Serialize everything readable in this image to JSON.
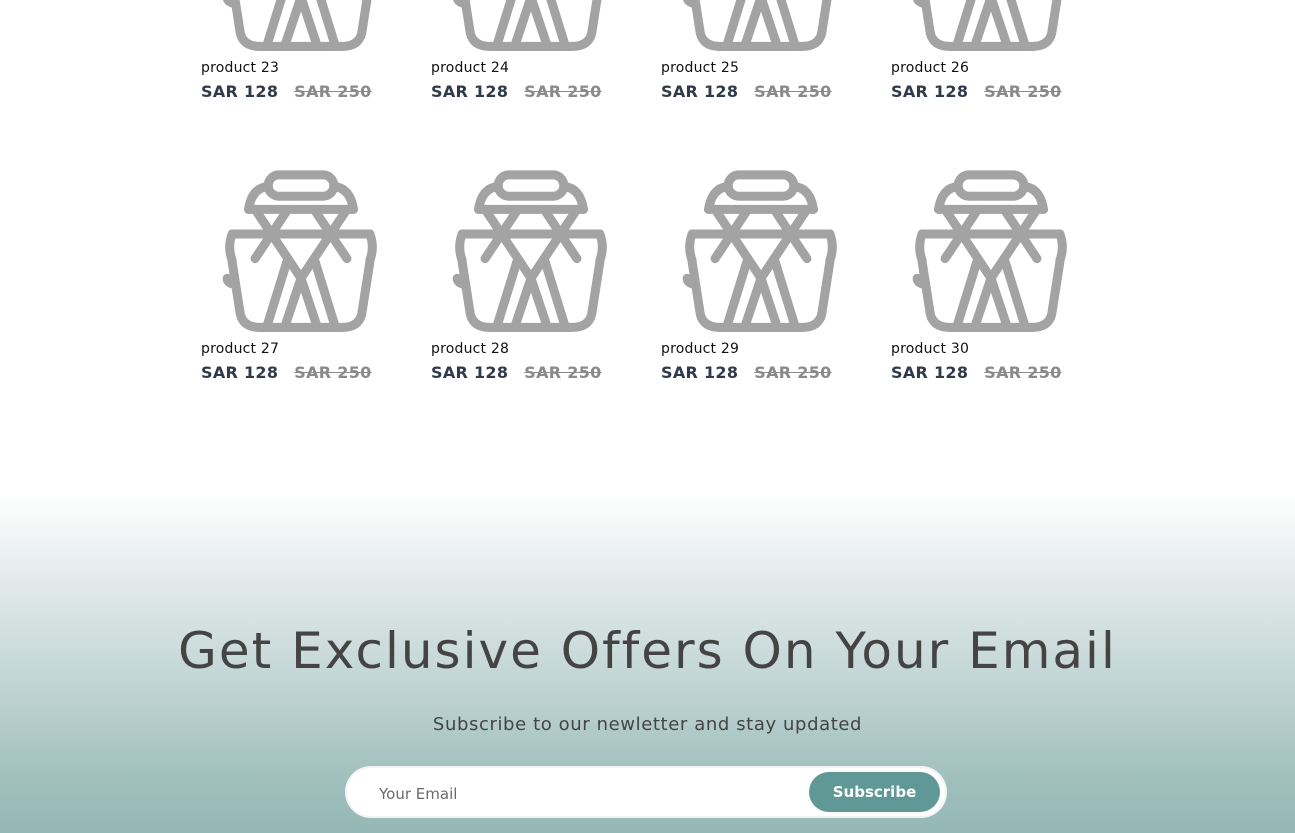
{
  "products": [
    {
      "name": "product 23",
      "price": "SAR 128",
      "old_price": "SAR 250"
    },
    {
      "name": "product 24",
      "price": "SAR 128",
      "old_price": "SAR 250"
    },
    {
      "name": "product 25",
      "price": "SAR 128",
      "old_price": "SAR 250"
    },
    {
      "name": "product 26",
      "price": "SAR 128",
      "old_price": "SAR 250"
    },
    {
      "name": "product 27",
      "price": "SAR 128",
      "old_price": "SAR 250"
    },
    {
      "name": "product 28",
      "price": "SAR 128",
      "old_price": "SAR 250"
    },
    {
      "name": "product 29",
      "price": "SAR 128",
      "old_price": "SAR 250"
    },
    {
      "name": "product 30",
      "price": "SAR 128",
      "old_price": "SAR 250"
    }
  ],
  "product_icon": "basket-placeholder-icon",
  "newsletter": {
    "title": "Get Exclusive Offers On Your Email",
    "subtitle": "Subscribe to our newletter and stay updated",
    "email_placeholder": "Your Email",
    "subscribe_label": "Subscribe"
  },
  "colors": {
    "price": "#2f3a4a",
    "old_price": "#8a8a8a",
    "icon": "#a3a3a3",
    "button": "#5f9895"
  }
}
